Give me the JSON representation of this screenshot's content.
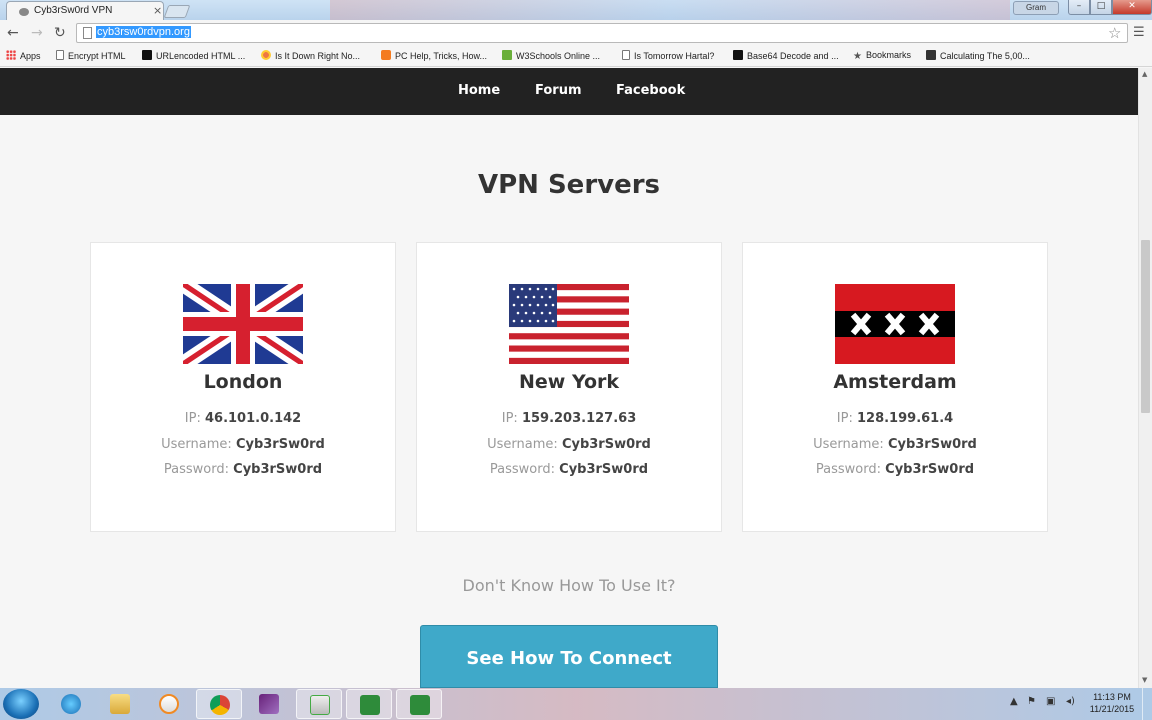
{
  "browser": {
    "tab_title": "Cyb3rSw0rd VPN",
    "tab_close": "×",
    "url": "cyb3rsw0rdvpn.org",
    "profile": "Gram",
    "bookmarks": [
      {
        "label": "Apps",
        "icon": "apps-grid-icon"
      },
      {
        "label": "Encrypt HTML",
        "icon": "page-icon"
      },
      {
        "label": "URLencoded HTML ...",
        "icon": "black-square-icon"
      },
      {
        "label": "Is It Down Right No...",
        "icon": "favicon-icon"
      },
      {
        "label": "PC Help, Tricks, How...",
        "icon": "blogger-icon"
      },
      {
        "label": "W3Schools Online ...",
        "icon": "w3schools-icon"
      },
      {
        "label": "Is Tomorrow Hartal?",
        "icon": "page-icon"
      },
      {
        "label": "Base64 Decode and ...",
        "icon": "b64-icon"
      },
      {
        "label": "Bookmarks",
        "icon": "star-icon"
      },
      {
        "label": "Calculating The 5,00...",
        "icon": "black-square-icon"
      }
    ]
  },
  "site_nav": {
    "home": "Home",
    "forum": "Forum",
    "facebook": "Facebook"
  },
  "main": {
    "title": "VPN Servers",
    "labels": {
      "ip": "IP:",
      "username": "Username:",
      "password": "Password:"
    },
    "servers": [
      {
        "city": "London",
        "ip": "46.101.0.142",
        "username": "Cyb3rSw0rd",
        "password": "Cyb3rSw0rd",
        "flag": "uk-flag"
      },
      {
        "city": "New York",
        "ip": "159.203.127.63",
        "username": "Cyb3rSw0rd",
        "password": "Cyb3rSw0rd",
        "flag": "us-flag"
      },
      {
        "city": "Amsterdam",
        "ip": "128.199.61.4",
        "username": "Cyb3rSw0rd",
        "password": "Cyb3rSw0rd",
        "flag": "amsterdam-flag"
      }
    ],
    "howto_text": "Don't Know How To Use It?",
    "connect_button": "See How To Connect"
  },
  "taskbar": {
    "time": "11:13 PM",
    "date": "11/21/2015"
  },
  "colors": {
    "nav_bg": "#222222",
    "button": "#3fa9c9",
    "url_highlight": "#3399ff"
  }
}
